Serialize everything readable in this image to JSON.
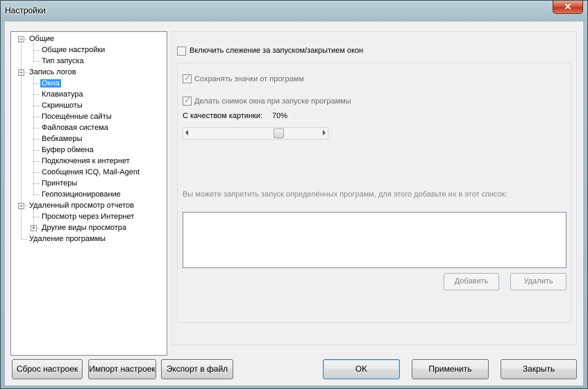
{
  "window": {
    "title": "Настройки",
    "close_glyph": "✕"
  },
  "tree": {
    "items": [
      {
        "label": "Общие",
        "level": 0,
        "expander": "−"
      },
      {
        "label": "Общие настройки",
        "level": 1
      },
      {
        "label": "Тип запуска",
        "level": 1
      },
      {
        "label": "Запись логов",
        "level": 0,
        "expander": "−"
      },
      {
        "label": "Окна",
        "level": 1,
        "selected": true
      },
      {
        "label": "Клавиатура",
        "level": 1
      },
      {
        "label": "Скриншоты",
        "level": 1
      },
      {
        "label": "Посещённые сайты",
        "level": 1
      },
      {
        "label": "Файловая система",
        "level": 1
      },
      {
        "label": "Вебкамеры",
        "level": 1
      },
      {
        "label": "Буфер обмена",
        "level": 1
      },
      {
        "label": "Подключения к интернет",
        "level": 1
      },
      {
        "label": "Сообщения ICQ, Mail-Agent",
        "level": 1
      },
      {
        "label": "Принтеры",
        "level": 1
      },
      {
        "label": "Геопозиционирование",
        "level": 1
      },
      {
        "label": "Удаленный просмотр отчетов",
        "level": 0,
        "expander": "−"
      },
      {
        "label": "Просмотр через Интернет",
        "level": 1
      },
      {
        "label": "Другие виды просмотра",
        "level": 1,
        "expander": "+"
      },
      {
        "label": "Удаление программы",
        "level": 0
      }
    ]
  },
  "settings": {
    "enable_tracking_label": "Включить слежение за запуском/закрытием окон",
    "enable_tracking_checked": false,
    "save_icons_label": "Сохранять значки от программ",
    "save_icons_checked": true,
    "snapshot_label": "Делать снимок окна при запуске программы",
    "snapshot_checked": true,
    "quality_label": "С качеством картинки:",
    "quality_value": "70%",
    "quality_slider_fraction": 0.7,
    "block_info": "Вы можете запретить запуск определённых программ, для этого добавьте их в этот список:",
    "blocked_programs": [],
    "add_button": "Добавить",
    "remove_button": "Удалить"
  },
  "footer": {
    "reset_button": "Сброс настроек",
    "import_button": "Импорт настроек",
    "export_button": "Экспорт в файл",
    "ok_button": "OK",
    "apply_button": "Применить",
    "close_button": "Закрыть"
  }
}
